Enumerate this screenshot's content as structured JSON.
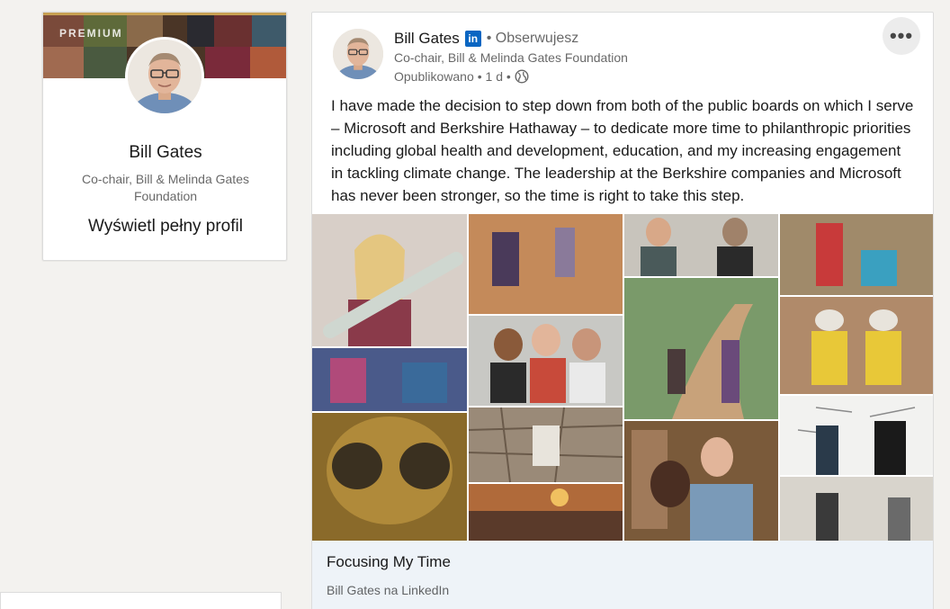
{
  "profile": {
    "premium_label": "PREMIUM",
    "name": "Bill Gates",
    "headline": "Co-chair, Bill & Melinda Gates Foundation",
    "view_profile_link": "Wyświetl pełny profil"
  },
  "post": {
    "author_name": "Bill Gates",
    "linkedin_badge": "in",
    "follow_status": "• Obserwujesz",
    "author_headline": "Co-chair, Bill & Melinda Gates Foundation",
    "published_label": "Opublikowano",
    "time_ago": "• 1 d •",
    "more_label": "•••",
    "text": "I have made the decision to step down from both of the public boards on which I serve – Microsoft and Berkshire Hathaway – to dedicate more time to philanthropic priorities including global health and development, education, and my increasing engagement in tackling climate change. The leadership at the Berkshire companies and Microsoft has never been stronger, so the time is right to take this step.",
    "link_title": "Focusing My Time",
    "link_source": "Bill Gates na LinkedIn"
  },
  "colors": {
    "linkedin_blue": "#0a66c2",
    "page_background": "#f3f2ef",
    "link_bar_background": "#eef3f8"
  }
}
